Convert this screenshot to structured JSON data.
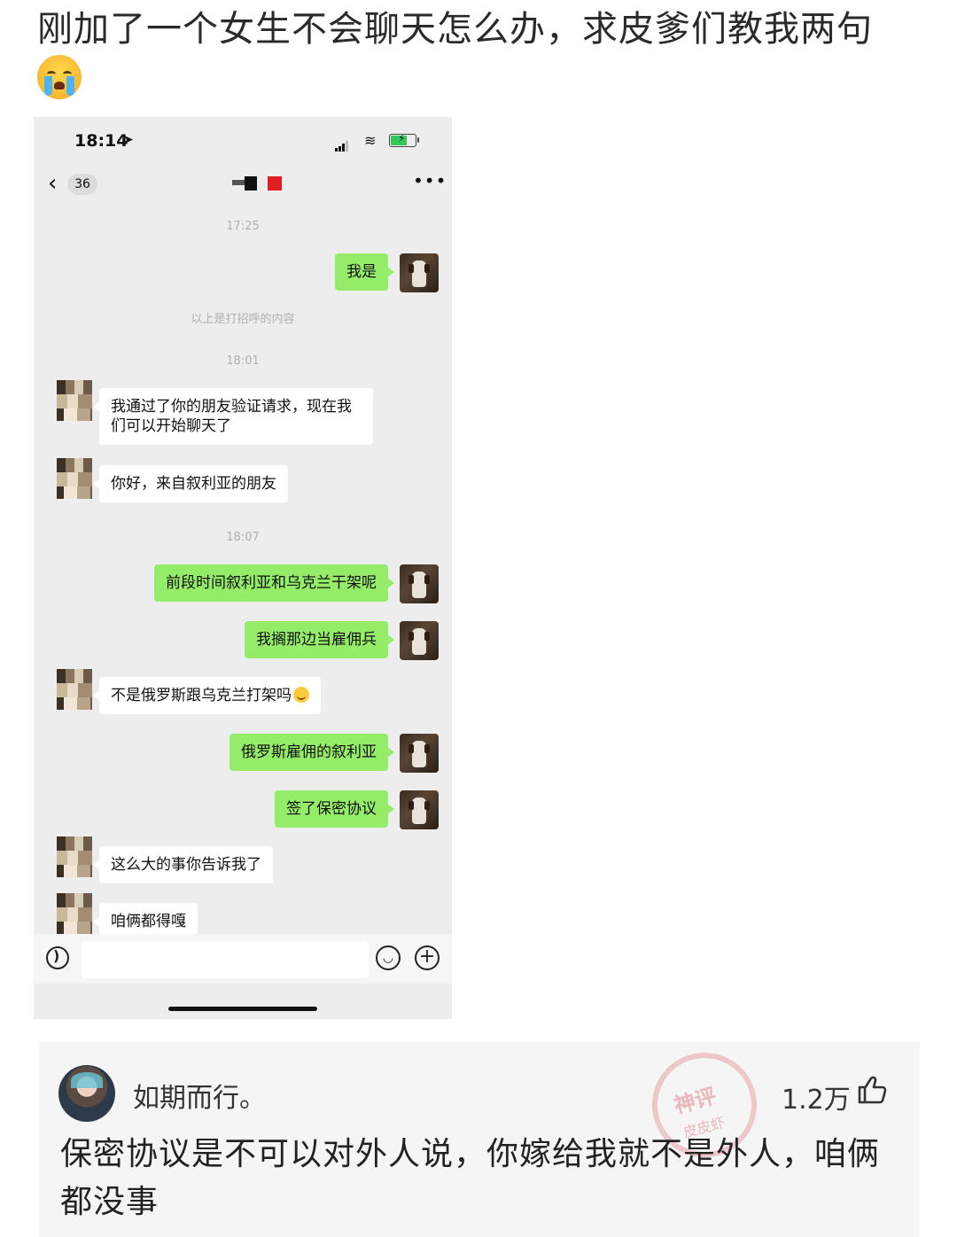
{
  "post": {
    "title": "刚加了一个女生不会聊天怎么办，求皮爹们教我两句",
    "title_emoji": "loudly-crying-face-icon"
  },
  "phone": {
    "status_time": "18:14",
    "back_count": "36",
    "messages": {
      "t1": "17:25",
      "m1": "我是",
      "note": "以上是打招呼的内容",
      "t2": "18:01",
      "m2": "我通过了你的朋友验证请求，现在我们可以开始聊天了",
      "m3": "你好，来自叙利亚的朋友",
      "t3": "18:07",
      "m4": "前段时间叙利亚和乌克兰干架呢",
      "m5": "我搁那边当雇佣兵",
      "m6": "不是俄罗斯跟乌克兰打架吗",
      "m7": "俄罗斯雇佣的叙利亚",
      "m8": "签了保密协议",
      "m9": "这么大的事你告诉我了",
      "m10": "咱俩都得嘎"
    }
  },
  "comment": {
    "username": "如期而行。",
    "likes": "1.2万",
    "text": "保密协议是不可以对外人说，你嫁给我就不是外人，咱俩都没事",
    "stamp_text": "神评",
    "stamp_sub": "皮皮虾"
  },
  "colors": {
    "my_bubble": "#95ec69",
    "their_bubble": "#ffffff",
    "chat_bg": "#ededed"
  }
}
